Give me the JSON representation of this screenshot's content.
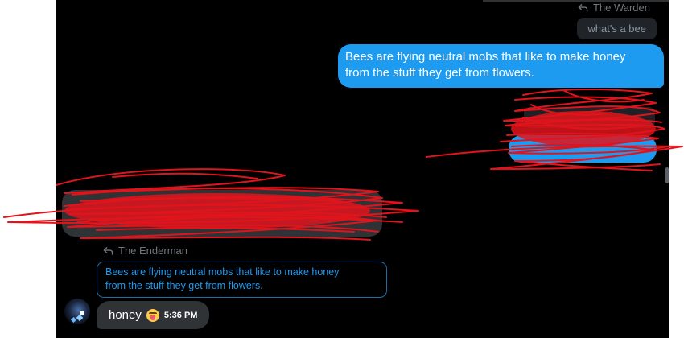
{
  "messages": {
    "sent_reply": {
      "reply_to": "The Warden",
      "quoted_text": "what's a bee",
      "lines": [
        "Bees are flying neutral mobs that like to make honey",
        "from the stuff they get from flowers."
      ]
    },
    "received_reply": {
      "reply_to": "The Enderman",
      "quoted_lines": [
        "Bees are flying neutral mobs that like to make honey",
        "from the stuff they get from flowers."
      ],
      "text": "honey",
      "emoji": "tongue-out-face",
      "time": "5:36 PM"
    }
  },
  "icons": {
    "reply": "reply-arrow-icon",
    "avatar": "avatar"
  },
  "colors": {
    "background": "#000000",
    "sent_bubble": "#1d9bf0",
    "received_bubble": "#2f3336",
    "muted_text": "#71767b",
    "scribble": "#e0141c"
  }
}
